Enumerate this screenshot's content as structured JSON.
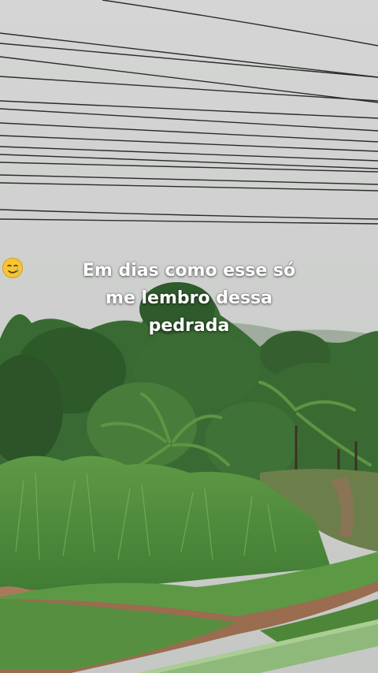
{
  "caption": {
    "line1": "Em dias como esse só",
    "line2": "me lembro dessa",
    "line3": "pedrada",
    "emoji": "smiling-face-with-tear-icon"
  },
  "colors": {
    "sky": "#cfd0cf",
    "wires": "#2a2a2a",
    "foliage_dark": "#2f5a2c",
    "foliage_mid": "#4f8a3c",
    "grass": "#6fa84e",
    "path": "#9a6c50",
    "railing": "#8fb97a"
  }
}
